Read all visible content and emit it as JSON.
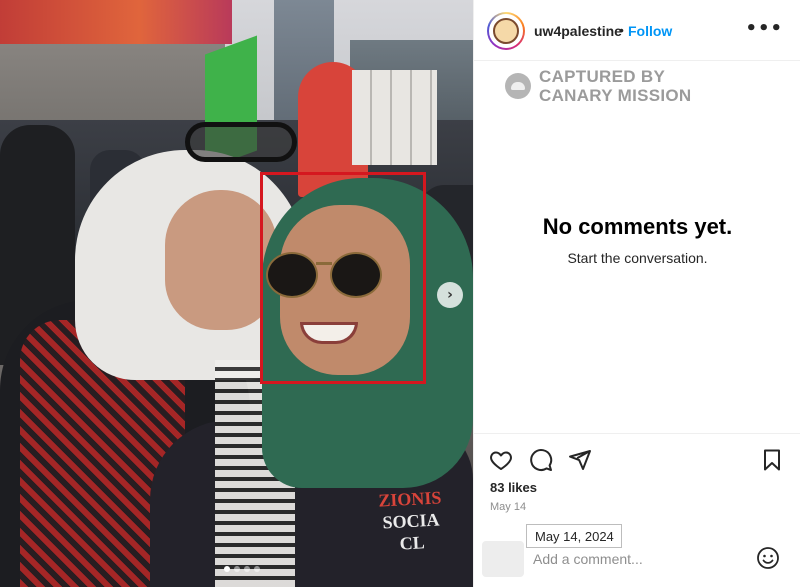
{
  "post": {
    "username": "uw4palestine",
    "separator": "•",
    "follow_label": "Follow",
    "more_label": "•••",
    "next_arrow": "›",
    "carousel_dots": 4,
    "carousel_active_index": 0
  },
  "photo": {
    "shirt_text_line1": "ZIONIS",
    "shirt_text_line2": "SOCIA",
    "shirt_text_line3": "CL"
  },
  "watermark": {
    "line1": "CAPTURED BY",
    "line2": "CANARY MISSION"
  },
  "comments": {
    "empty_title": "No comments yet.",
    "empty_subtitle": "Start the conversation."
  },
  "engagement": {
    "likes": "83 likes",
    "date": "May 14",
    "date_tooltip": "May 14, 2024"
  },
  "comment_box": {
    "placeholder": "Add a comment..."
  },
  "icons": {
    "like": "heart-icon",
    "comment": "comment-icon",
    "share": "share-icon",
    "save": "bookmark-icon",
    "emoji": "emoji-icon"
  },
  "colors": {
    "link_blue": "#0095f6",
    "highlight_box": "#d5171f",
    "muted_text": "#8e8e8e"
  }
}
